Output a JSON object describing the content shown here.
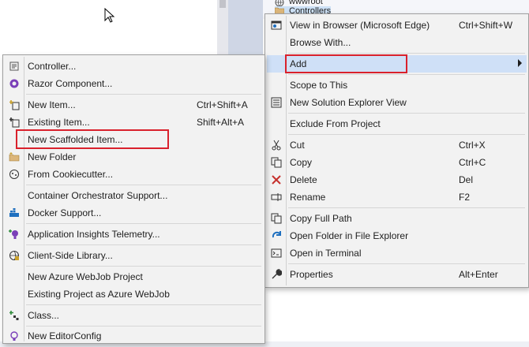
{
  "solution_explorer": {
    "rows": [
      {
        "label": "wwwroot",
        "icon": "globe-icon"
      },
      {
        "label": "Controllers",
        "icon": "folder-icon"
      }
    ]
  },
  "context_menu": {
    "items": [
      {
        "label": "View in Browser (Microsoft Edge)",
        "shortcut": "Ctrl+Shift+W",
        "icon": "browser-icon"
      },
      {
        "label": "Browse With...",
        "shortcut": "",
        "icon": ""
      },
      {
        "label": "Add",
        "shortcut": "",
        "icon": "",
        "submenu": true,
        "highlighted": true
      },
      {
        "label": "Scope to This",
        "shortcut": "",
        "icon": ""
      },
      {
        "label": "New Solution Explorer View",
        "shortcut": "",
        "icon": "solution-explorer-icon"
      },
      {
        "label": "Exclude From Project",
        "shortcut": "",
        "icon": ""
      },
      {
        "label": "Cut",
        "shortcut": "Ctrl+X",
        "icon": "scissors-icon"
      },
      {
        "label": "Copy",
        "shortcut": "Ctrl+C",
        "icon": "copy-icon"
      },
      {
        "label": "Delete",
        "shortcut": "Del",
        "icon": "delete-x-icon"
      },
      {
        "label": "Rename",
        "shortcut": "F2",
        "icon": "rename-icon"
      },
      {
        "label": "Copy Full Path",
        "shortcut": "",
        "icon": "copy-path-icon"
      },
      {
        "label": "Open Folder in File Explorer",
        "shortcut": "",
        "icon": "open-folder-arrow-icon"
      },
      {
        "label": "Open in Terminal",
        "shortcut": "",
        "icon": "terminal-icon"
      },
      {
        "label": "Properties",
        "shortcut": "Alt+Enter",
        "icon": "wrench-icon"
      }
    ]
  },
  "add_submenu": {
    "items": [
      {
        "label": "Controller...",
        "shortcut": "",
        "icon": "controller-icon"
      },
      {
        "label": "Razor Component...",
        "shortcut": "",
        "icon": "razor-icon"
      },
      {
        "label": "New Item...",
        "shortcut": "Ctrl+Shift+A",
        "icon": "new-item-icon"
      },
      {
        "label": "Existing Item...",
        "shortcut": "Shift+Alt+A",
        "icon": "existing-item-icon"
      },
      {
        "label": "New Scaffolded Item...",
        "shortcut": "",
        "icon": ""
      },
      {
        "label": "New Folder",
        "shortcut": "",
        "icon": "new-folder-icon"
      },
      {
        "label": "From Cookiecutter...",
        "shortcut": "",
        "icon": "cookiecutter-icon"
      },
      {
        "label": "Container Orchestrator Support...",
        "shortcut": "",
        "icon": ""
      },
      {
        "label": "Docker Support...",
        "shortcut": "",
        "icon": "docker-icon"
      },
      {
        "label": "Application Insights Telemetry...",
        "shortcut": "",
        "icon": "app-insights-icon"
      },
      {
        "label": "Client-Side Library...",
        "shortcut": "",
        "icon": "client-library-icon"
      },
      {
        "label": "New Azure WebJob Project",
        "shortcut": "",
        "icon": ""
      },
      {
        "label": "Existing Project as Azure WebJob",
        "shortcut": "",
        "icon": ""
      },
      {
        "label": "Class...",
        "shortcut": "",
        "icon": "class-icon"
      },
      {
        "label": "New EditorConfig",
        "shortcut": "",
        "icon": "editorconfig-icon"
      }
    ]
  }
}
